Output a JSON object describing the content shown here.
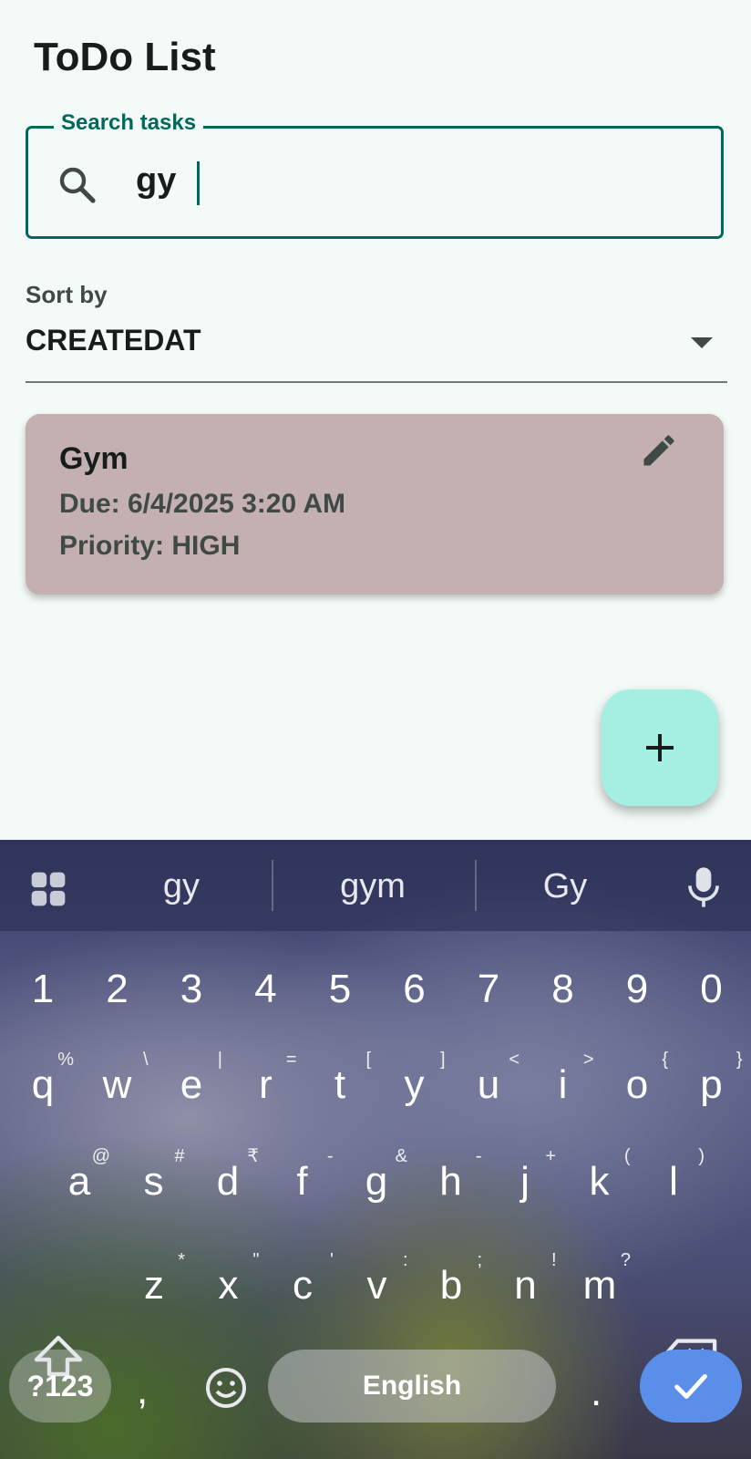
{
  "app": {
    "title": "ToDo List"
  },
  "search": {
    "label": "Search tasks",
    "value": "gy"
  },
  "sort": {
    "label": "Sort by",
    "value": "CREATEDAT"
  },
  "tasks": [
    {
      "title": "Gym",
      "due": "Due: 6/4/2025 3:20 AM",
      "priority": "Priority: HIGH"
    }
  ],
  "fab": {
    "icon": "plus-icon"
  },
  "keyboard": {
    "suggestions": [
      "gy",
      "gym",
      "Gy"
    ],
    "number_row": [
      "1",
      "2",
      "3",
      "4",
      "5",
      "6",
      "7",
      "8",
      "9",
      "0"
    ],
    "row1": [
      {
        "key": "q",
        "hint": "%"
      },
      {
        "key": "w",
        "hint": "\\"
      },
      {
        "key": "e",
        "hint": "|"
      },
      {
        "key": "r",
        "hint": "="
      },
      {
        "key": "t",
        "hint": "["
      },
      {
        "key": "y",
        "hint": "]"
      },
      {
        "key": "u",
        "hint": "<"
      },
      {
        "key": "i",
        "hint": ">"
      },
      {
        "key": "o",
        "hint": "{"
      },
      {
        "key": "p",
        "hint": "}"
      }
    ],
    "row2": [
      {
        "key": "a",
        "hint": "@"
      },
      {
        "key": "s",
        "hint": "#"
      },
      {
        "key": "d",
        "hint": "₹"
      },
      {
        "key": "f",
        "hint": "-"
      },
      {
        "key": "g",
        "hint": "&"
      },
      {
        "key": "h",
        "hint": "-"
      },
      {
        "key": "j",
        "hint": "+"
      },
      {
        "key": "k",
        "hint": "("
      },
      {
        "key": "l",
        "hint": ")"
      }
    ],
    "row3": [
      {
        "key": "z",
        "hint": "*"
      },
      {
        "key": "x",
        "hint": "\""
      },
      {
        "key": "c",
        "hint": "'"
      },
      {
        "key": "v",
        "hint": ":"
      },
      {
        "key": "b",
        "hint": ";"
      },
      {
        "key": "n",
        "hint": "!"
      },
      {
        "key": "m",
        "hint": "?"
      }
    ],
    "symbols_label": "?123",
    "comma": ",",
    "space_label": "English",
    "period": ".",
    "accent_color": "#5b8ee8"
  }
}
